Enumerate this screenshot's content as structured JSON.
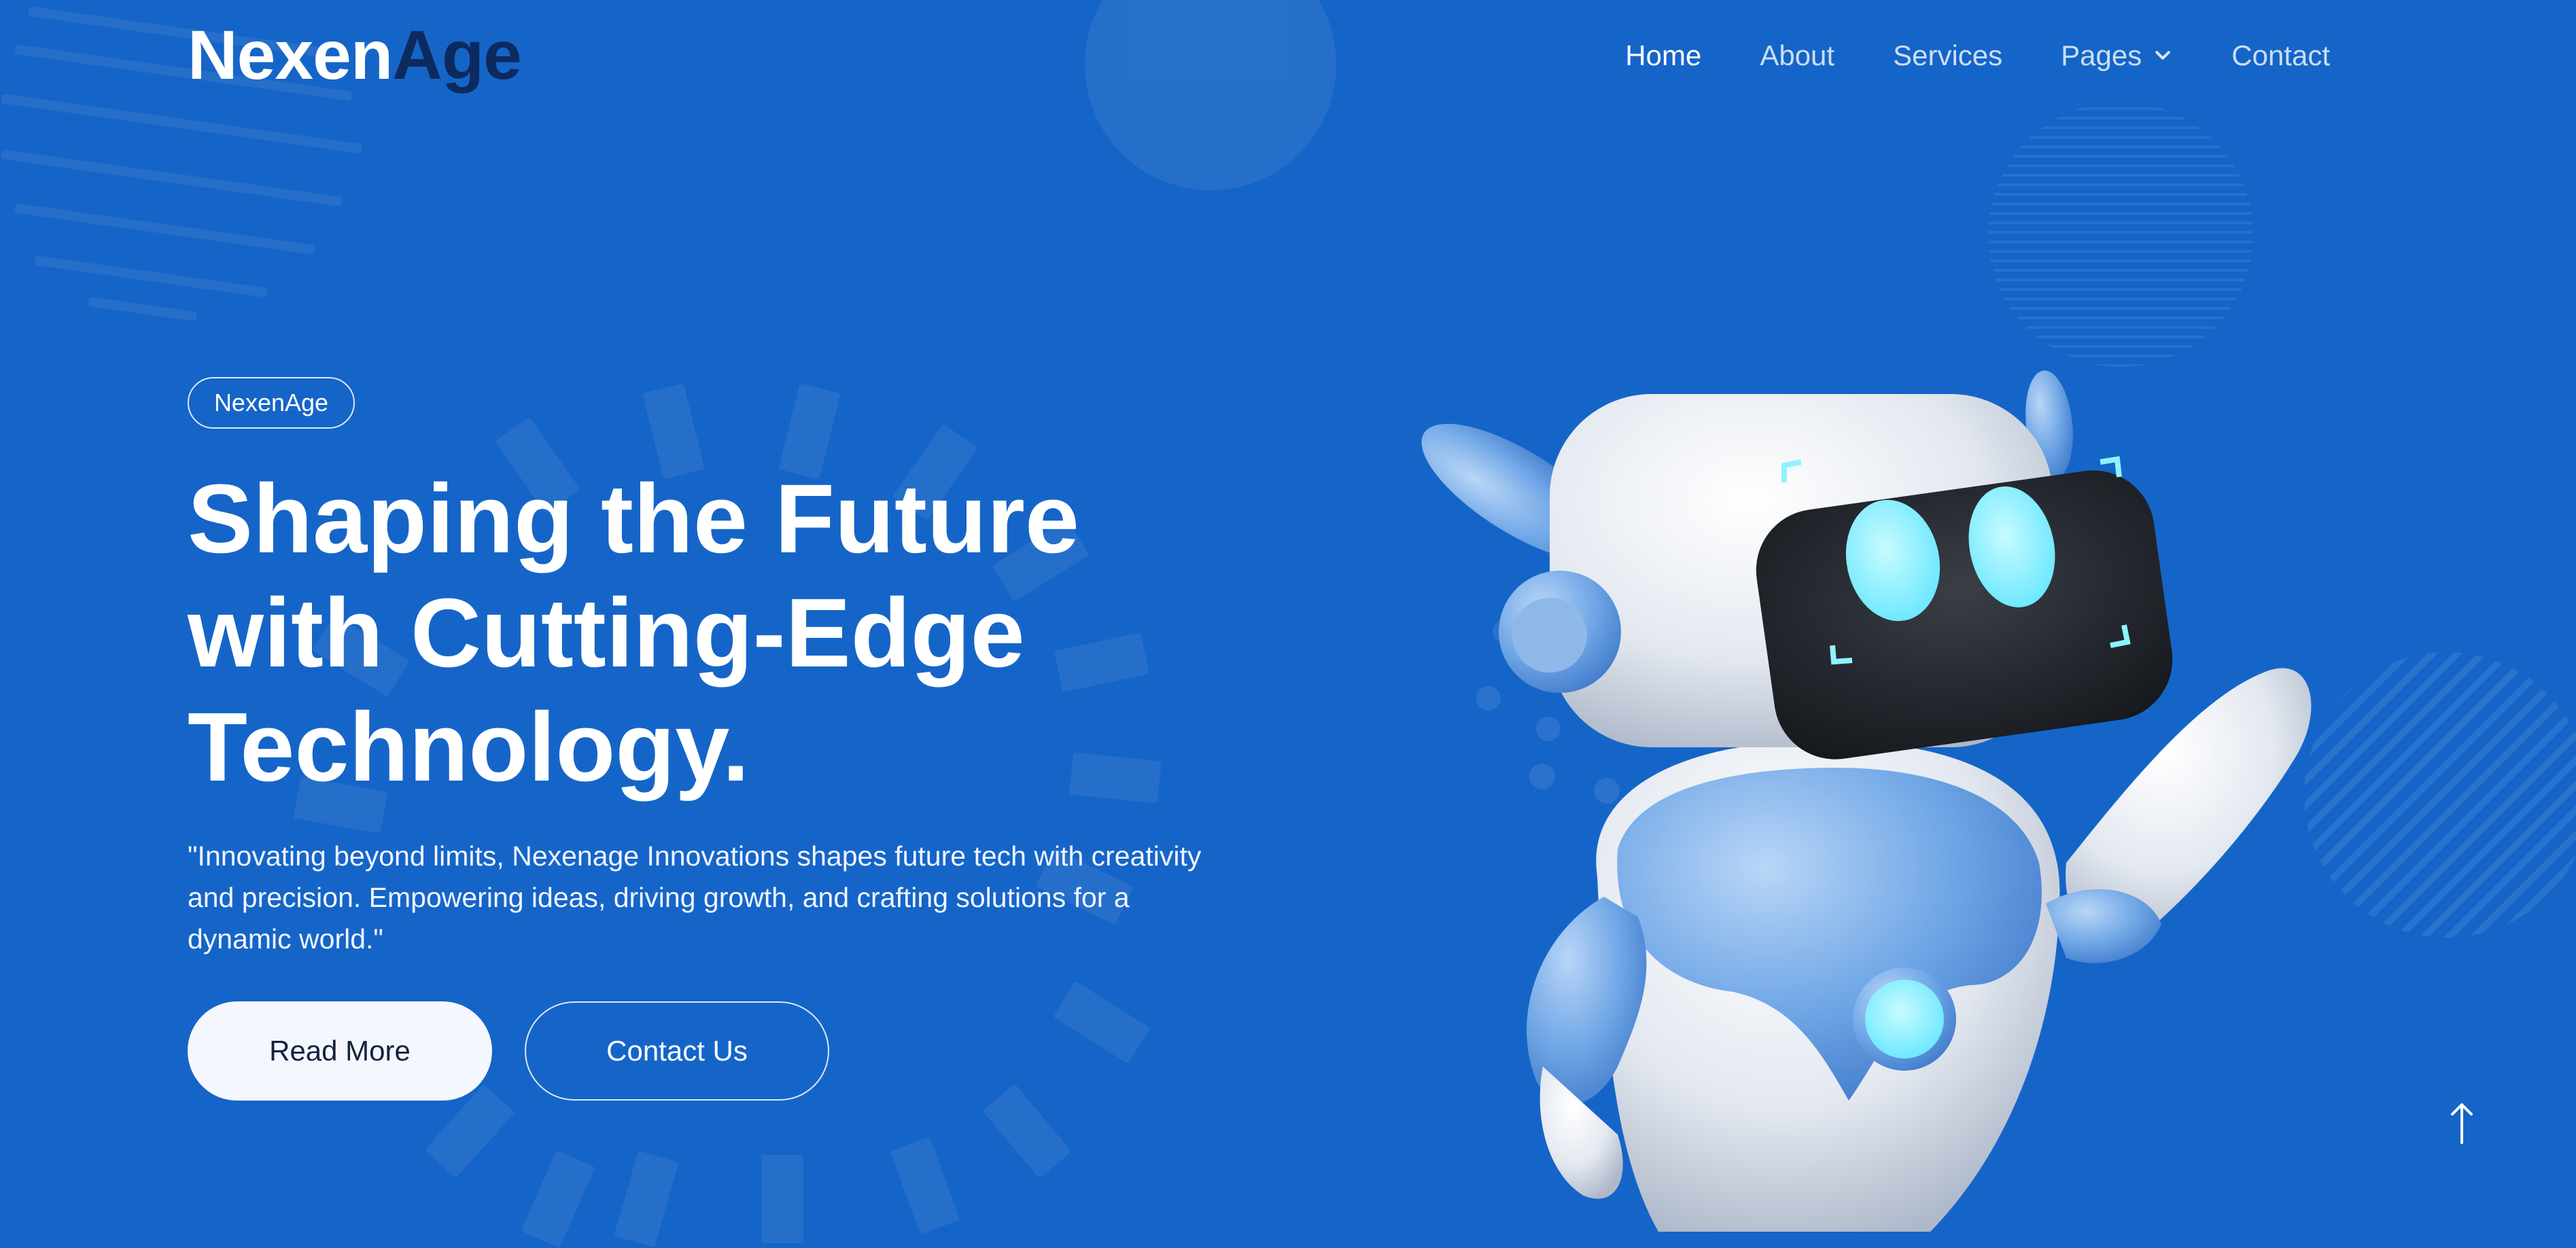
{
  "brand": {
    "part1": "Nexen",
    "part2": "Age"
  },
  "nav": {
    "items": [
      {
        "label": "Home",
        "active": true
      },
      {
        "label": "About",
        "active": false
      },
      {
        "label": "Services",
        "active": false
      },
      {
        "label": "Pages",
        "active": false,
        "dropdown": true
      },
      {
        "label": "Contact",
        "active": false
      }
    ]
  },
  "hero": {
    "badge": "NexenAge",
    "title_lines": [
      "Shaping the Future",
      "with Cutting-Edge",
      "Technology."
    ],
    "description_lines": [
      "\"Innovating beyond limits, Nexenage Innovations shapes future tech with creativity",
      "and precision. Empowering ideas, driving growth, and crafting solutions for a",
      "dynamic world.\""
    ],
    "primary_button": "Read More",
    "secondary_button": "Contact Us"
  },
  "icons": {
    "scroll_top": "arrow-up-icon",
    "nav_dropdown": "chevron-down-icon",
    "hero_image": "robot-mascot"
  },
  "colors": {
    "background": "#1565c8",
    "logo_accent": "#0d2a5e",
    "button_light": "#f4f7fe",
    "robot_eye": "#8ff2ff"
  }
}
